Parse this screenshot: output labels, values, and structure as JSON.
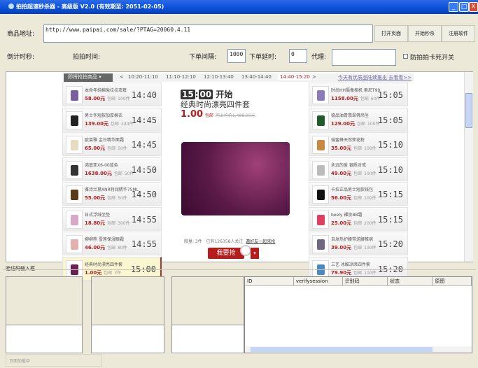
{
  "window": {
    "title": "拍拍超速秒杀器 - 高级版 V2.0  (有效期至: 2051-02-05)",
    "minimize": "_",
    "maximize": "□",
    "close": "X"
  },
  "toolbar": {
    "url_label": "商品地址:",
    "url_value": "http://www.paipai.com/sale/?PTAG=20060.4.11",
    "open_page": "打开页面",
    "start_seckill": "开始秒杀",
    "register": "注册软件",
    "countdown_label": "倒计时秒:",
    "paipai_time_label": "拍拍时间:",
    "order_interval_label": "下单间隔:",
    "order_interval_value": "1000",
    "order_delay_label": "下单延时:",
    "order_delay_value": "0",
    "proxy_label": "代理:",
    "proxy_value": "",
    "anti_freeze_label": "防拍拍卡死开关",
    "anti_freeze_checked": false
  },
  "tabs": {
    "dropdown": "即将抢拍商品 ▾",
    "prev": "<",
    "next": ">",
    "items": [
      "10:20-11:10",
      "11:10-12:10",
      "12:10-13:40",
      "13:40-14:40",
      "14:40-15:20"
    ],
    "active": "14:40-15:20",
    "promo_link": "今天有优质品陆续推出 去看看>>"
  },
  "left_list": [
    {
      "name": "本命年纯棉兔拉拉弯裤",
      "price": "58.00元",
      "ship": "包邮",
      "qty": "100件",
      "time": "14:40",
      "color": "#7a5fa0"
    },
    {
      "name": "男士冬短款加厚棉衣",
      "price": "139.00元",
      "ship": "包邮",
      "qty": "240件",
      "time": "14:45",
      "color": "#222"
    },
    {
      "name": "欧莱雅 金日精华面霜",
      "price": "65.00元",
      "ship": "包邮",
      "qty": "50件",
      "time": "14:45",
      "color": "#e8dcc0"
    },
    {
      "name": "诺基亚X6-00蓝色",
      "price": "1638.00元",
      "ship": "包邮",
      "qty": "50件",
      "time": "14:50",
      "color": "#333"
    },
    {
      "name": "雅诗兰黛ANR特润精华75ML",
      "price": "55.00元",
      "ship": "包邮",
      "qty": "50件",
      "time": "14:50",
      "color": "#5a3a18"
    },
    {
      "name": "日式浮绒坐垫",
      "price": "18.80元",
      "ship": "包邮",
      "qty": "300件",
      "time": "14:55",
      "color": "#d8a8c8"
    },
    {
      "name": "柳柳熊 雪莲保湿眼霜",
      "price": "46.00元",
      "ship": "包邮",
      "qty": "80件",
      "time": "14:55",
      "color": "#e6b0b0"
    },
    {
      "name": "经典时尚漂亮四件套",
      "price": "1.00元",
      "ship": "包邮",
      "qty": "3件",
      "time": "15:00",
      "color": "#6a2050",
      "highlight": true
    }
  ],
  "right_list": [
    {
      "name": "时尚HH摄像相机 索尼T99",
      "price": "1158.00元",
      "ship": "包邮",
      "qty": "60件",
      "time": "15:05",
      "color": "#8a7ab8"
    },
    {
      "name": "极品油青翡翠佛吊坠",
      "price": "129.00元",
      "ship": "包邮",
      "qty": "100件",
      "time": "15:05",
      "color": "#1f5a2a"
    },
    {
      "name": "瑞蜜蜂天然荣花粉",
      "price": "35.00元",
      "ship": "包邮",
      "qty": "100件",
      "time": "15:10",
      "color": "#c88a40"
    },
    {
      "name": "永远的爱 银质对戒",
      "price": "49.00元",
      "ship": "包邮",
      "qty": "100件",
      "time": "15:10",
      "color": "#bbb"
    },
    {
      "name": "卡拉正品男士短款钱包",
      "price": "56.00元",
      "ship": "包邮",
      "qty": "100件",
      "time": "15:15",
      "color": "#111"
    },
    {
      "name": "beely 裸妆BB霜",
      "price": "25.00元",
      "ship": "包邮",
      "qty": "200件",
      "time": "15:15",
      "color": "#e04060"
    },
    {
      "name": "自发热护腰带送腰椎病",
      "price": "39.00元",
      "ship": "包邮",
      "qty": "100件",
      "time": "15:20",
      "color": "#706880"
    },
    {
      "name": "三艺 冰酷凉席四件套",
      "price": "79.90元",
      "ship": "包邮",
      "qty": "100件",
      "time": "15:20",
      "color": "#4a8ac0"
    }
  ],
  "featured": {
    "hour": "15",
    "minute": "00",
    "start": "开始",
    "title": "经典时尚漂亮四件套",
    "price": "1.00",
    "ship": "包邮",
    "ref_price": "网上均价1,488.00元",
    "limit": "限量: 3件",
    "followers": "已有126358人关注",
    "invite": "邀好友一起来抢",
    "grab_button": "我要抢"
  },
  "captcha": {
    "group_label": "验证码输入框",
    "table_headers": [
      "ID",
      "verifysession",
      "识别码",
      "状态",
      "原图"
    ]
  },
  "status": {
    "text": "页面加载中"
  }
}
